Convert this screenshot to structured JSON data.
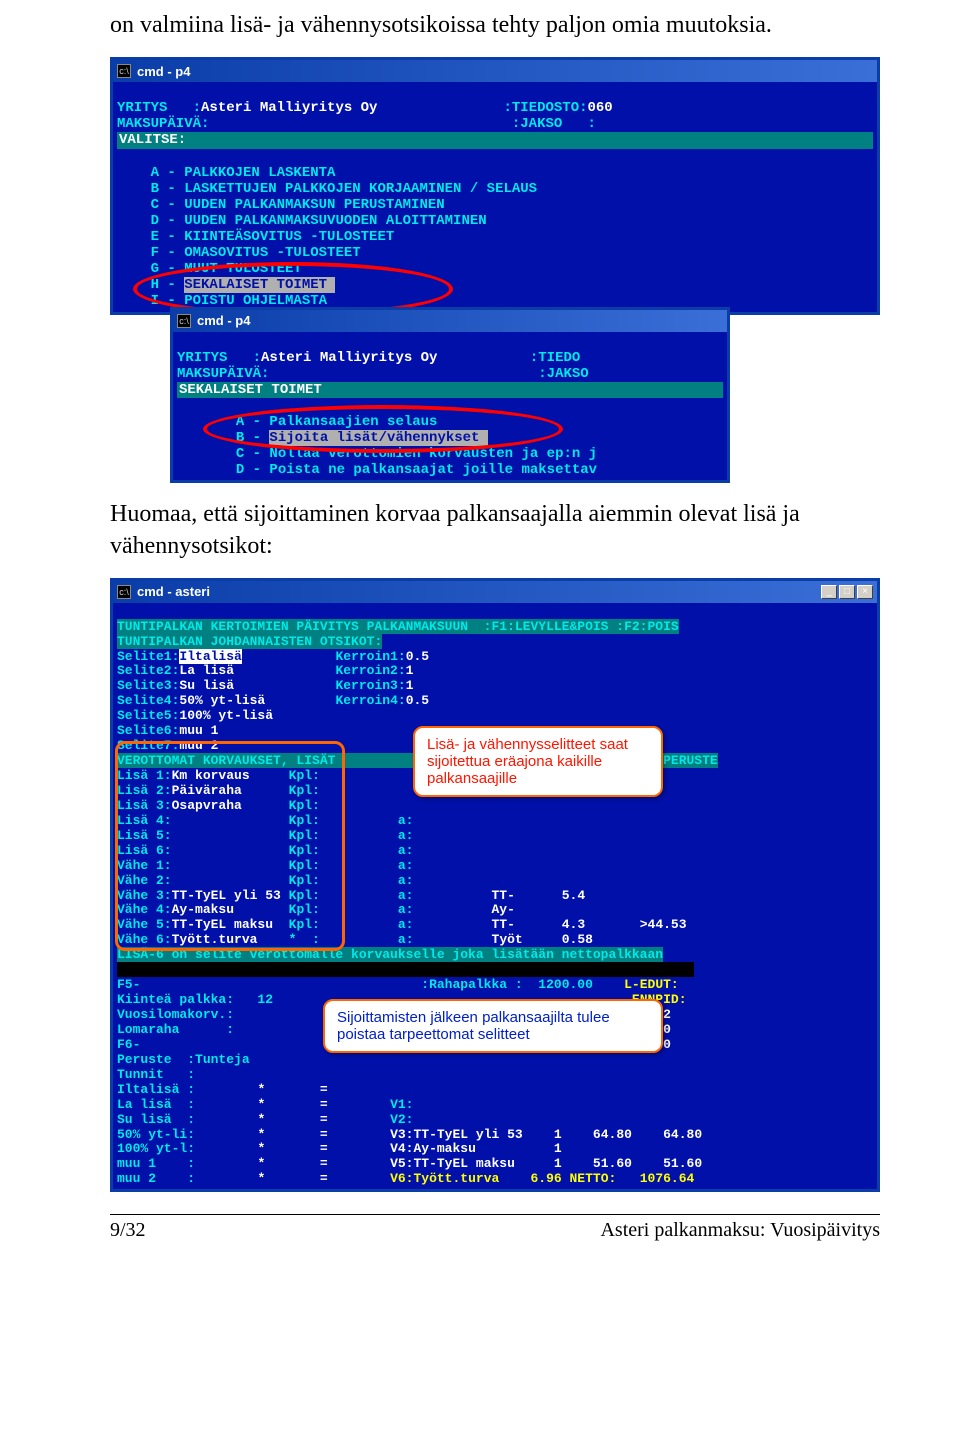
{
  "intro": "on valmiina lisä- ja vähennysotsikoissa tehty paljon omia muutoksia.",
  "win1": {
    "title": "cmd - p4",
    "hdr": {
      "yritys_label": "YRITYS   :",
      "yritys_val": "Asteri Malliyritys Oy",
      "tiedosto_label": ":TIEDOSTO:",
      "tiedosto_val": "060",
      "maksu_label": "MAKSUPÄIVÄ:",
      "jakso_label": ":JAKSO   :"
    },
    "section": "VALITSE:",
    "items": {
      "a": "A - PALKKOJEN LASKENTA",
      "b": "B - LASKETTUJEN PALKKOJEN KORJAAMINEN / SELAUS",
      "c": "C - UUDEN PALKANMAKSUN PERUSTAMINEN",
      "d": "D - UUDEN PALKANMAKSUVUODEN ALOITTAMINEN",
      "e": "E - KIINTEÄSOVITUS -TULOSTEET",
      "f": "F - OMASOVITUS -TULOSTEET",
      "g": "G - MUUT TULOSTEET",
      "h": "H - SEKALAISET TOIMET",
      "i": "I - POISTU OHJELMASTA"
    }
  },
  "win2": {
    "title": "cmd - p4",
    "hdr": {
      "yritys_label": "YRITYS   :",
      "yritys_val": "Asteri Malliyritys Oy",
      "tiedosto_label": ":TIEDO",
      "maksu_label": "MAKSUPÄIVÄ:",
      "jakso_label": ":JAKSO"
    },
    "section": "SEKALAISET TOIMET",
    "items": {
      "a": "A - Palkansaajien selaus",
      "b": "B - Sijoita lisät/vähennykset",
      "c": "C - Nollaa verottomien korvausten ja ep:n j",
      "d": "D - Poista ne palkansaajat joille maksettav"
    }
  },
  "midtext": "Huomaa, että sijoittaminen korvaa palkansaajalla aiemmin olevat lisä ja vähennysotsikot:",
  "win3": {
    "title": "cmd - asteri",
    "top1": "TUNTIPALKAN KERTOIMIEN PÄIVITYS PALKANMAKSUUN  :F1:LEVYLLE&POIS :F2:POIS",
    "top2": "TUNTIPALKAN JOHDANNAISTEN OTSIKOT:",
    "selites": [
      {
        "l": "Selite1:",
        "v": "Iltalisä",
        "k": "Kerroin1:",
        "kv": "0.5"
      },
      {
        "l": "Selite2:",
        "v": "La lisä",
        "k": "Kerroin2:",
        "kv": "1"
      },
      {
        "l": "Selite3:",
        "v": "Su lisä",
        "k": "Kerroin3:",
        "kv": "1"
      },
      {
        "l": "Selite4:",
        "v": "50% yt-lisä",
        "k": "Kerroin4:",
        "kv": "0.5"
      },
      {
        "l": "Selite5:",
        "v": "100% yt-lisä",
        "k": "",
        "kv": ""
      },
      {
        "l": "Selite6:",
        "v": "muu 1",
        "k": "",
        "kv": ""
      },
      {
        "l": "Selite7:",
        "v": "muu 2",
        "k": "",
        "kv": ""
      }
    ],
    "row_hdr": "VEROTTOMAT KORVAUKSET, LISÄT                                    S  PV PERUSTE",
    "lisa": [
      {
        "n": "Lisä 1:",
        "v": "Km korvaus",
        "c": "Kpl:"
      },
      {
        "n": "Lisä 2:",
        "v": "Päiväraha",
        "c": "Kpl:"
      },
      {
        "n": "Lisä 3:",
        "v": "Osapvraha",
        "c": "Kpl:"
      },
      {
        "n": "Lisä 4:",
        "v": "",
        "c": "Kpl:",
        "a": "a:"
      },
      {
        "n": "Lisä 5:",
        "v": "",
        "c": "Kpl:",
        "a": "a:"
      },
      {
        "n": "Lisä 6:",
        "v": "",
        "c": "Kpl:",
        "a": "a:"
      }
    ],
    "vahe": [
      {
        "n": "Vähe 1:",
        "v": "",
        "c": "Kpl:",
        "a": "a:",
        "r": ""
      },
      {
        "n": "Vähe 2:",
        "v": "",
        "c": "Kpl:",
        "a": "a:",
        "r": ""
      },
      {
        "n": "Vähe 3:",
        "v": "TT-TyEL yli 53",
        "c": "Kpl:",
        "a": "a:",
        "r": "TT-      5.4"
      },
      {
        "n": "Vähe 4:",
        "v": "Ay-maksu",
        "c": "Kpl:",
        "a": "a:",
        "r": "Ay-"
      },
      {
        "n": "Vähe 5:",
        "v": "TT-TyEL maksu",
        "c": "Kpl:",
        "a": "a:",
        "r": "TT-      4.3       >44.53"
      },
      {
        "n": "Vähe 6:",
        "v": "Tyött.turva",
        "c": "*  :",
        "a": "a:",
        "r": "Työt     0.58"
      }
    ],
    "bot_green": "LISÄ-6 on selite verottomalle korvaukselle joka lisätään nettopalkkaan",
    "bottom": {
      "f5": "F5-",
      "rahapalkka": ":Rahapalkka :  1200.00",
      "ledut": "L-EDUT:",
      "kiintea": "Kiinteä palkka:   12",
      "ennpid": "ENNPID:",
      "vuosiloma": "Vuosilomakorv.:",
      "vuosiloma_v": "0.42",
      "lomaraha": "Lomaraha      :",
      "lomaraha_v": "30.00",
      "f6": "F6-",
      "f6_v": "14.00",
      "peruste": "Peruste  :Tunteja",
      "tunnit": "Tunnit   :",
      "rows": [
        {
          "l": "Iltalisä :",
          "m": "*       =",
          "r": ""
        },
        {
          "l": "La lisä  :",
          "m": "*       =",
          "r": "V1:"
        },
        {
          "l": "Su lisä  :",
          "m": "*       =",
          "r": "V2:"
        },
        {
          "l": "50% yt-li:",
          "m": "*       =",
          "r": "V3:TT-TyEL yli 53    1    64.80    64.80"
        },
        {
          "l": "100% yt-l:",
          "m": "*       =",
          "r": "V4:Ay-maksu          1"
        },
        {
          "l": "muu 1    :",
          "m": "*       =",
          "r": "V5:TT-TyEL maksu     1    51.60    51.60"
        },
        {
          "l": "muu 2    :",
          "m": "*       =",
          "r": "V6:Tyött.turva    6.96 NETTO:   1076.64"
        }
      ]
    },
    "callout1": "Lisä- ja vähennysselitteet saat sijoitettua eräajona kaikille palkansaajille",
    "callout2": "Sijoittamisten jälkeen palkansaajilta tulee poistaa tarpeettomat selitteet"
  },
  "footer": {
    "left": "9/32",
    "right": "Asteri palkanmaksu: Vuosipäivitys"
  }
}
